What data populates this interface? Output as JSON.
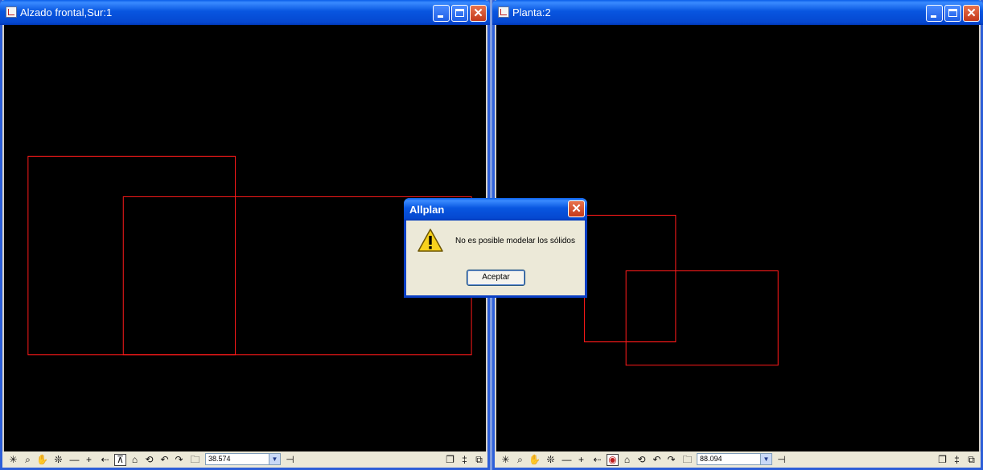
{
  "windows": [
    {
      "title": "Alzado frontal,Sur:1",
      "zoom_value": "38.574"
    },
    {
      "title": "Planta:2",
      "zoom_value": "88.094"
    }
  ],
  "dialog": {
    "title": "Allplan",
    "message": "No es posible modelar los sólidos",
    "ok_label": "Aceptar",
    "icon": "warning-icon"
  },
  "colors": {
    "titlebar": "#0a5ee8",
    "canvas": "#000000",
    "drawing_lines": "#ff1a1a",
    "chrome": "#ece9d8"
  },
  "toolbar_icons": [
    "select-all-icon",
    "zoom-icon",
    "pan-hand-icon",
    "regenerate-icon",
    "horizontal-line-icon",
    "crosshair-icon",
    "arrow-left-icon",
    "snap-icon",
    "render-icon",
    "rotate-icon",
    "undo-view-icon",
    "redo-view-icon",
    "open-view-icon",
    "pin-icon",
    "window-icon",
    "split-icon",
    "copy-icon"
  ]
}
